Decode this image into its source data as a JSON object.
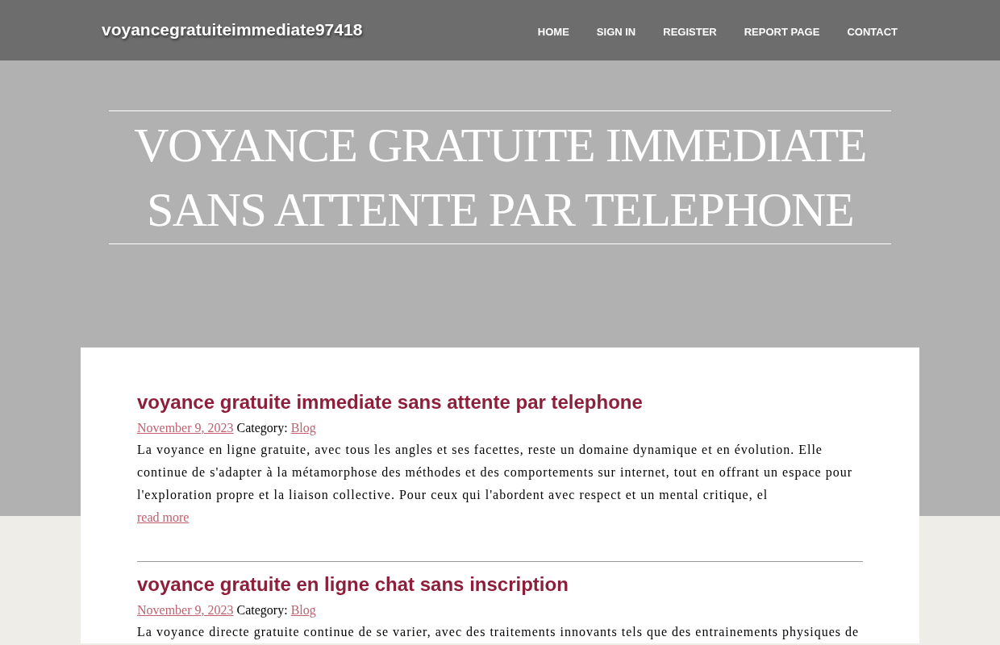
{
  "site_title": "voyancegratuiteimmediate97418",
  "nav": [
    {
      "label": "HOME"
    },
    {
      "label": "SIGN IN"
    },
    {
      "label": "REGISTER"
    },
    {
      "label": "REPORT PAGE"
    },
    {
      "label": "CONTACT"
    }
  ],
  "hero": {
    "title": "VOYANCE GRATUITE IMMEDIATE SANS ATTENTE PAR TELEPHONE"
  },
  "posts": [
    {
      "title": "voyance gratuite immediate sans attente par telephone",
      "date": "November 9, 2023",
      "category_label": "Category:",
      "category": "Blog",
      "excerpt": "La voyance en ligne gratuite, avec tous les angles et ses facettes, reste un domaine dynamique et en évolution. Elle continue de s'adapter à la métamorphose des méthodes et des comportements sur internet, tout en offrant un espace pour l'exploration propre et la liaison collective. Pour ceux qui l'abordent avec respect et un mental critique, el",
      "read_more": "read more"
    },
    {
      "title": "voyance gratuite en ligne chat sans inscription",
      "date": "November 9, 2023",
      "category_label": "Category:",
      "category": "Blog",
      "excerpt": "La voyance directe gratuite continue de se varier, avec des traitements innovants tels que des entrainements physiques de"
    }
  ]
}
